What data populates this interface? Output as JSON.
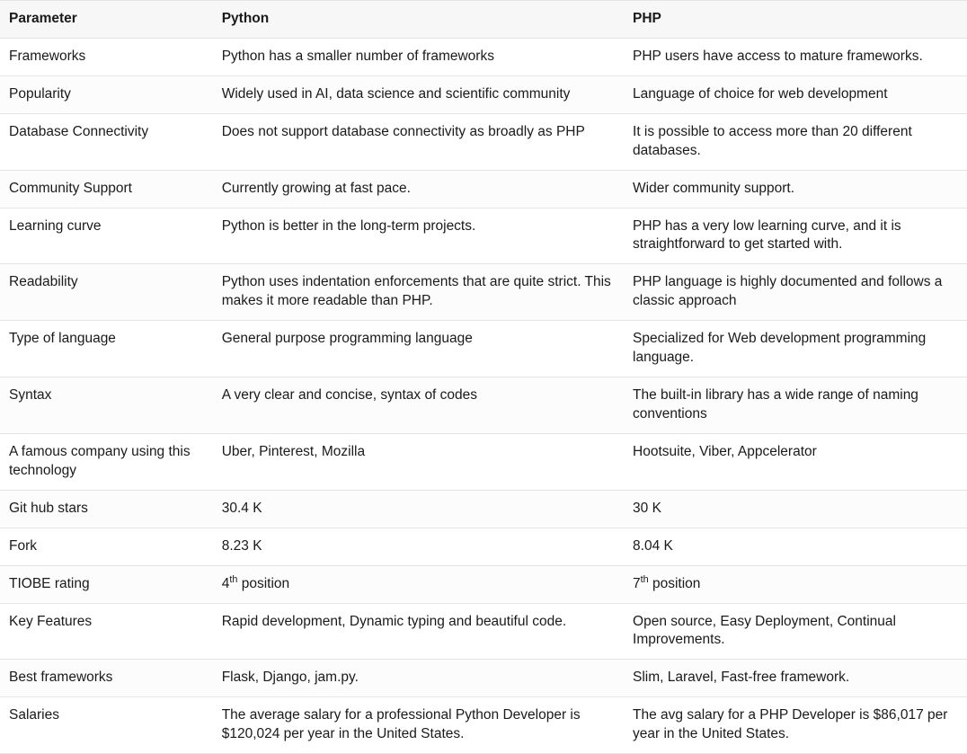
{
  "headers": {
    "param": "Parameter",
    "python": "Python",
    "php": "PHP"
  },
  "rows": [
    {
      "param": "Frameworks",
      "python": "Python has a smaller number of frameworks",
      "php": "PHP users have access to mature frameworks."
    },
    {
      "param": "Popularity",
      "python": "Widely used in AI, data science and scientific community",
      "php": "Language of choice for web development"
    },
    {
      "param": "Database Connectivity",
      "python": "Does not support database connectivity as broadly as PHP",
      "php": "It is possible to access more than 20 different databases."
    },
    {
      "param": "Community Support",
      "python": "Currently growing at fast pace.",
      "php": "Wider community support."
    },
    {
      "param": "Learning curve",
      "python": "Python is better in the long-term projects.",
      "php": "PHP has a very low learning curve, and it is straightforward to get started with."
    },
    {
      "param": "Readability",
      "python": "Python uses indentation enforcements that are quite strict. This makes it more readable than PHP.",
      "php": "PHP language is highly documented and follows a classic approach"
    },
    {
      "param": "Type of language",
      "python": "General purpose programming language",
      "php": "Specialized for Web development programming language."
    },
    {
      "param": "Syntax",
      "python": "A very clear and concise, syntax of codes",
      "php": "The built-in library has a wide range of naming conventions"
    },
    {
      "param": "A famous company using this technology",
      "python": "Uber, Pinterest, Mozilla",
      "php": "Hootsuite, Viber, Appcelerator"
    },
    {
      "param": "Git hub stars",
      "python": "30.4 K",
      "php": "30 K"
    },
    {
      "param": "Fork",
      "python": "8.23 K",
      "php": "8.04 K"
    },
    {
      "param": "TIOBE rating",
      "python_html": "4<sup>th</sup> position",
      "php_html": "7<sup>th</sup> position"
    },
    {
      "param": "Key Features",
      "python": "Rapid development, Dynamic typing and beautiful code.",
      "php": "Open source, Easy Deployment, Continual Improvements."
    },
    {
      "param": "Best frameworks",
      "python": "Flask, Django, jam.py.",
      "php": "Slim, Laravel, Fast-free framework."
    },
    {
      "param": "Salaries",
      "python": "The average salary for a professional Python Developer is $120,024 per year in the United States.",
      "php": "The avg salary for a PHP Developer is $86,017 per year in the United States."
    }
  ]
}
